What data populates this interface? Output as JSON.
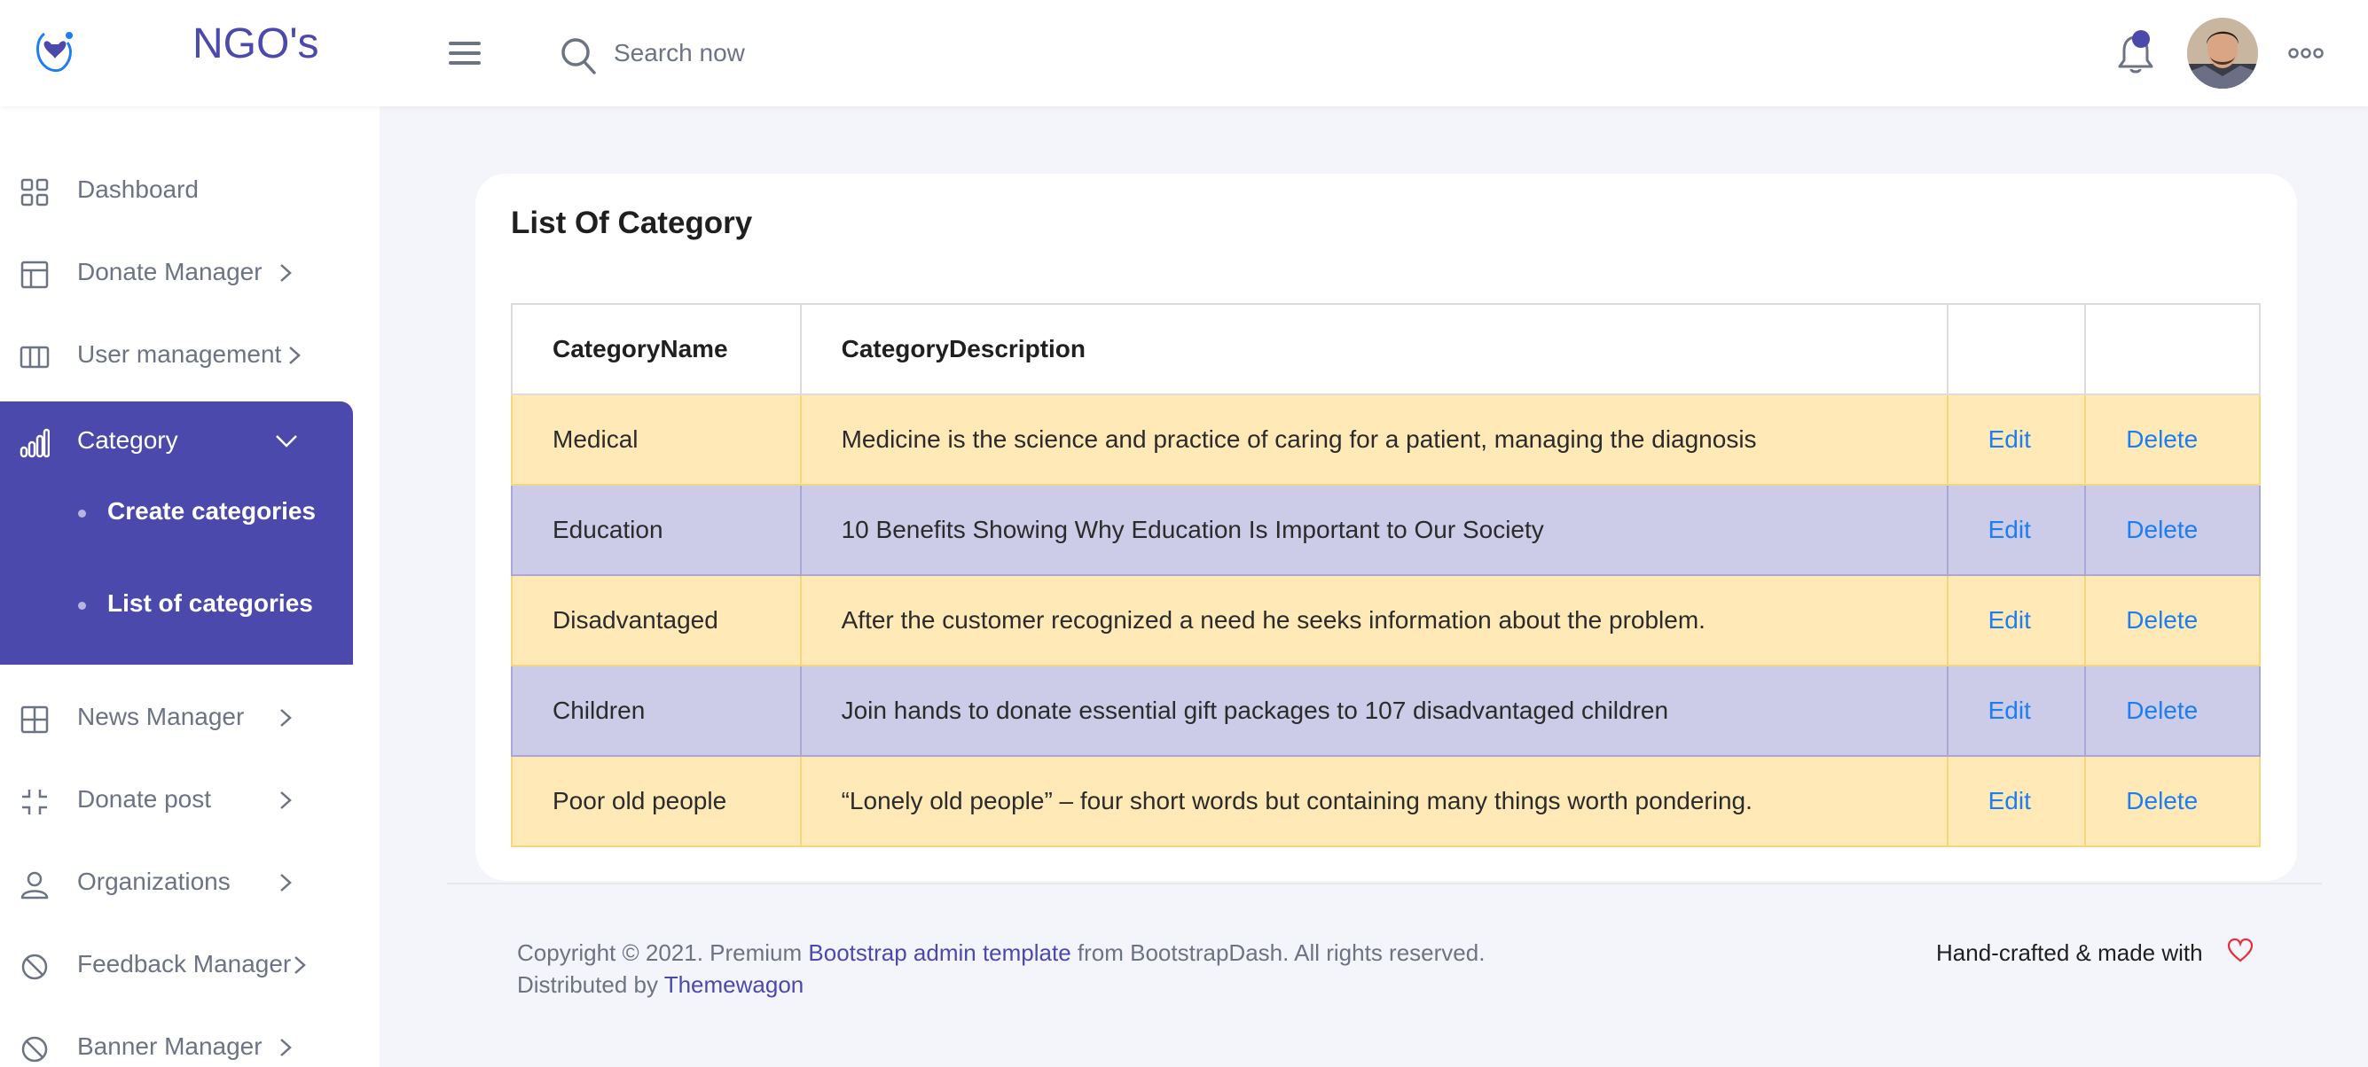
{
  "header": {
    "brand": "NGO's",
    "search_placeholder": "Search now"
  },
  "sidebar": {
    "items": [
      {
        "label": "Dashboard",
        "icon": "grid-icon"
      },
      {
        "label": "Donate Manager",
        "icon": "layout-icon"
      },
      {
        "label": "User management",
        "icon": "columns-icon"
      },
      {
        "label": "Category",
        "icon": "bar-chart-icon",
        "active": true
      },
      {
        "label": "News Manager",
        "icon": "table-icon"
      },
      {
        "label": "Donate post",
        "icon": "expand-icon"
      },
      {
        "label": "Organizations",
        "icon": "user-icon"
      },
      {
        "label": "Feedback Manager",
        "icon": "ban-icon"
      },
      {
        "label": "Banner Manager",
        "icon": "ban-icon"
      }
    ],
    "category_sub": [
      "Create categories",
      "List of categories"
    ]
  },
  "main": {
    "title": "List Of Category",
    "columns": [
      "CategoryName",
      "CategoryDescription",
      "",
      ""
    ],
    "rows": [
      {
        "name": "Medical",
        "description": "Medicine is the science and practice of caring for a patient, managing the diagnosis",
        "edit": "Edit",
        "delete": "Delete"
      },
      {
        "name": "Education",
        "description": "10 Benefits Showing Why Education Is Important to Our Society",
        "edit": "Edit",
        "delete": "Delete"
      },
      {
        "name": "Disadvantaged",
        "description": "After the customer recognized a need he seeks information about the problem.",
        "edit": "Edit",
        "delete": "Delete"
      },
      {
        "name": "Children",
        "description": "Join hands to donate essential gift packages to 107 disadvantaged children",
        "edit": "Edit",
        "delete": "Delete"
      },
      {
        "name": "Poor old people",
        "description": "“Lonely old people” – four short words but containing many things worth pondering.",
        "edit": "Edit",
        "delete": "Delete"
      }
    ]
  },
  "footer": {
    "copyright_prefix": "Copyright © 2021. Premium ",
    "bootstrap_link": "Bootstrap admin template",
    "copyright_suffix": " from BootstrapDash. All rights reserved.",
    "distributed_prefix": "Distributed by ",
    "themewagon_link": "Themewagon",
    "handcrafted": "Hand-crafted & made with"
  },
  "colors": {
    "primary": "#4b49ac",
    "warning_row": "#ffeab7",
    "info_row": "#cccbe8",
    "link": "#1c7ef2",
    "heart": "#e8303c"
  }
}
